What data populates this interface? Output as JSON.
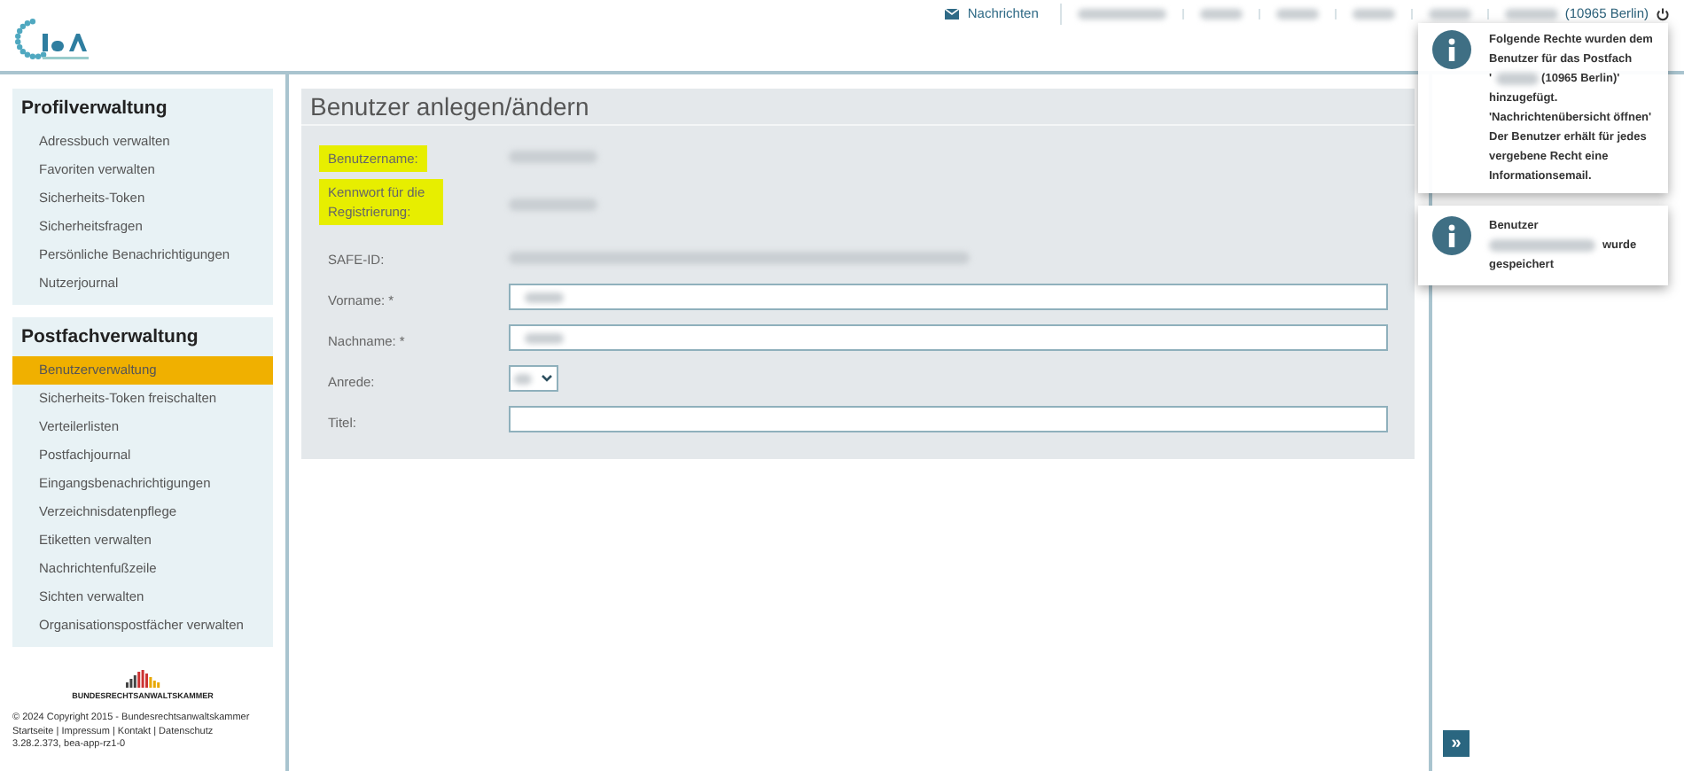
{
  "header": {
    "nav": [
      {
        "kind": "link",
        "label": "Nachrichten"
      },
      {
        "kind": "redacted"
      },
      {
        "kind": "redacted"
      },
      {
        "kind": "redacted"
      },
      {
        "kind": "redacted"
      },
      {
        "kind": "redacted"
      }
    ],
    "user": {
      "suffix": "(10965 Berlin)"
    }
  },
  "sidebar": {
    "sections": [
      {
        "title": "Profilverwaltung",
        "items": [
          {
            "label": "Adressbuch verwalten",
            "selected": false
          },
          {
            "label": "Favoriten verwalten",
            "selected": false
          },
          {
            "label": "Sicherheits-Token",
            "selected": false
          },
          {
            "label": "Sicherheitsfragen",
            "selected": false
          },
          {
            "label": "Persönliche Benachrichtigungen",
            "selected": false
          },
          {
            "label": "Nutzerjournal",
            "selected": false
          }
        ]
      },
      {
        "title": "Postfachverwaltung",
        "items": [
          {
            "label": "Benutzerverwaltung",
            "selected": true
          },
          {
            "label": "Sicherheits-Token freischalten",
            "selected": false
          },
          {
            "label": "Verteilerlisten",
            "selected": false
          },
          {
            "label": "Postfachjournal",
            "selected": false
          },
          {
            "label": "Eingangsbenachrichtigungen",
            "selected": false
          },
          {
            "label": "Verzeichnisdatenpflege",
            "selected": false
          },
          {
            "label": "Etiketten verwalten",
            "selected": false
          },
          {
            "label": "Nachrichtenfußzeile",
            "selected": false
          },
          {
            "label": "Sichten verwalten",
            "selected": false
          },
          {
            "label": "Organisationspostfächer verwalten",
            "selected": false
          }
        ]
      }
    ],
    "footer": {
      "org": "BUNDESRECHTSANWALTSKAMMER",
      "copyright": "© 2024 Copyright 2015 - Bundesrechtsanwaltskammer",
      "links": "Startseite | Impressum | Kontakt | Datenschutz",
      "version": "3.28.2.373, bea-app-rz1-0"
    }
  },
  "form": {
    "title": "Benutzer anlegen/ändern",
    "rows": [
      {
        "label": "Benutzername:",
        "highlighted": true,
        "kind": "redacted"
      },
      {
        "label": "Kennwort für die Registrierung:",
        "highlighted": true,
        "kind": "redacted"
      },
      {
        "label": "SAFE-ID:",
        "highlighted": false,
        "kind": "redacted_long"
      },
      {
        "label": "Vorname: *",
        "highlighted": false,
        "kind": "input_redacted"
      },
      {
        "label": "Nachname: *",
        "highlighted": false,
        "kind": "input_redacted"
      },
      {
        "label": "Anrede:",
        "highlighted": false,
        "kind": "select"
      },
      {
        "label": "Titel:",
        "highlighted": false,
        "kind": "input"
      }
    ]
  },
  "notifications": [
    {
      "kind": "rights",
      "line_1": "Folgende Rechte wurden dem Benutzer für das Postfach",
      "quote_open": "'",
      "mailbox_suffix": "(10965 Berlin)'",
      "line_2": "hinzugefügt.",
      "right": "'Nachrichtenübersicht öffnen'",
      "note": "Der Benutzer erhält für jedes vergebene Recht eine Informationsemail."
    },
    {
      "kind": "saved",
      "line_1": "Benutzer",
      "word": "wurde",
      "line_2": "gespeichert"
    }
  ],
  "panel_toggle": "»"
}
